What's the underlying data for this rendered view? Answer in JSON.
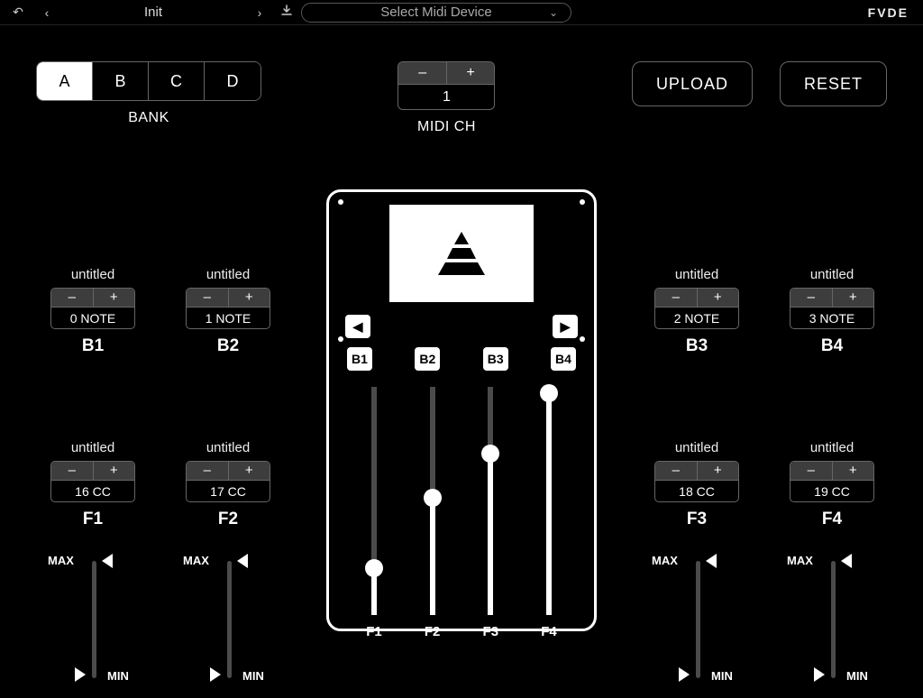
{
  "toolbar": {
    "preset_name": "Init",
    "midi_device_placeholder": "Select Midi Device",
    "logo": "FVDE"
  },
  "bank": {
    "label": "BANK",
    "options": [
      "A",
      "B",
      "C",
      "D"
    ],
    "active": "A"
  },
  "midi_ch": {
    "label": "MIDI CH",
    "value": "1"
  },
  "actions": {
    "upload": "UPLOAD",
    "reset": "RESET"
  },
  "device": {
    "buttons": [
      "B1",
      "B2",
      "B3",
      "B4"
    ],
    "faders": [
      {
        "label": "F1",
        "pos": 0.18
      },
      {
        "label": "F2",
        "pos": 0.5
      },
      {
        "label": "F3",
        "pos": 0.7
      },
      {
        "label": "F4",
        "pos": 0.97
      }
    ]
  },
  "notes": {
    "left": [
      {
        "title": "untitled",
        "value": "0 NOTE",
        "label": "B1"
      },
      {
        "title": "untitled",
        "value": "1 NOTE",
        "label": "B2"
      }
    ],
    "right": [
      {
        "title": "untitled",
        "value": "2 NOTE",
        "label": "B3"
      },
      {
        "title": "untitled",
        "value": "3 NOTE",
        "label": "B4"
      }
    ]
  },
  "ccs": {
    "left": [
      {
        "title": "untitled",
        "value": "16 CC",
        "label": "F1"
      },
      {
        "title": "untitled",
        "value": "17 CC",
        "label": "F2"
      }
    ],
    "right": [
      {
        "title": "untitled",
        "value": "18 CC",
        "label": "F3"
      },
      {
        "title": "untitled",
        "value": "19 CC",
        "label": "F4"
      }
    ]
  },
  "range": {
    "max": "MAX",
    "min": "MIN"
  },
  "glyph": {
    "minus": "–",
    "plus": "+"
  }
}
